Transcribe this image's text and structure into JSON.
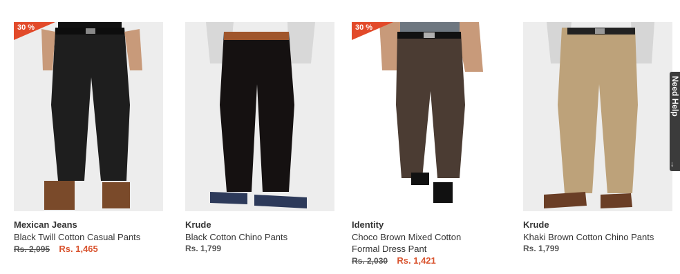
{
  "products": [
    {
      "brand": "Mexican Jeans",
      "name": "Black Twill Cotton Casual Pants",
      "old_price": "Rs. 2,095",
      "price": "Rs. 1,465",
      "discount": "30 %",
      "pant_color": "#1e1e1e",
      "shoe_color": "#7a4a2a"
    },
    {
      "brand": "Krude",
      "name": "Black Cotton Chino Pants",
      "price_plain": "Rs. 1,799",
      "pant_color": "#151111",
      "shoe_color": "#2d3a5a"
    },
    {
      "brand": "Identity",
      "name": "Choco Brown Mixed Cotton Formal Dress Pant",
      "old_price": "Rs. 2,030",
      "price": "Rs. 1,421",
      "discount": "30 %",
      "pant_color": "#4b3c33",
      "shoe_color": "#111111"
    },
    {
      "brand": "Krude",
      "name": "Khaki Brown Cotton Chino Pants",
      "price_plain": "Rs. 1,799",
      "pant_color": "#bda27a",
      "shoe_color": "#6a3e26"
    }
  ],
  "help_tab": {
    "label": "Need Help",
    "arrow": "↓"
  },
  "colors": {
    "accent": "#d9532e",
    "badge": "#e24a2a"
  }
}
